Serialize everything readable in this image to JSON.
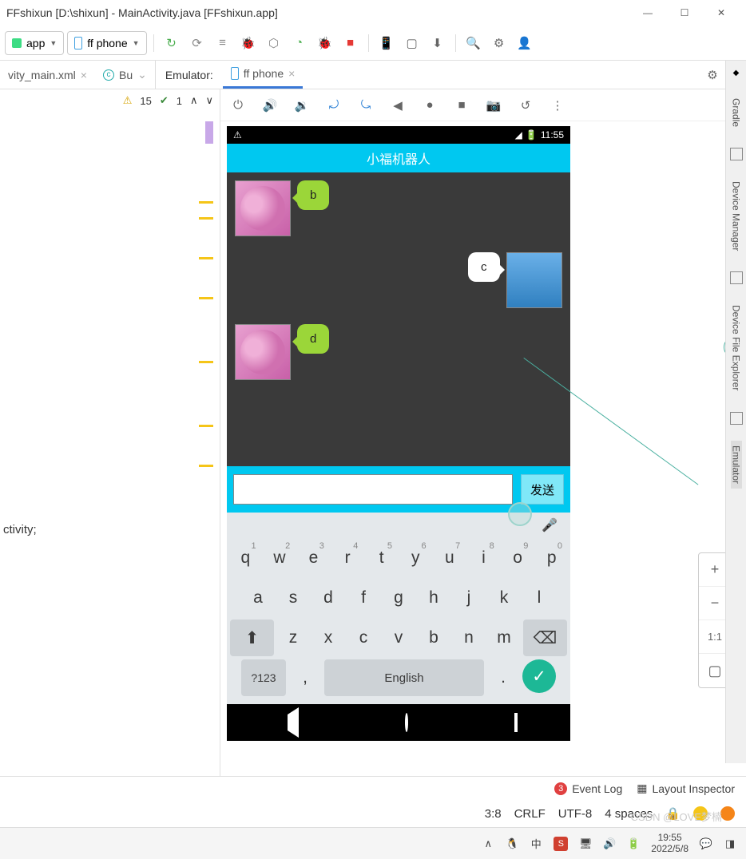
{
  "titlebar": {
    "text": "FFshixun [D:\\shixun] - MainActivity.java [FFshixun.app]"
  },
  "toolbar": {
    "module": "app",
    "device": "ff phone"
  },
  "tabs": {
    "left1": "vity_main.xml",
    "left2": "Bu",
    "emulator_label": "Emulator:",
    "emu_tab": "ff phone"
  },
  "warnings": {
    "warn_count": "15",
    "ok_count": "1"
  },
  "code": {
    "line": "ctivity;"
  },
  "phone": {
    "status_time": "11:55",
    "app_title": "小福机器人",
    "msgs": [
      {
        "side": "left",
        "text": "b",
        "bubble": "green"
      },
      {
        "side": "right",
        "text": "c",
        "bubble": "white"
      },
      {
        "side": "left",
        "text": "d",
        "bubble": "green"
      }
    ],
    "send": "发送",
    "input_value": ""
  },
  "keyboard": {
    "row1": [
      {
        "k": "q",
        "s": "1"
      },
      {
        "k": "w",
        "s": "2"
      },
      {
        "k": "e",
        "s": "3"
      },
      {
        "k": "r",
        "s": "4"
      },
      {
        "k": "t",
        "s": "5"
      },
      {
        "k": "y",
        "s": "6"
      },
      {
        "k": "u",
        "s": "7"
      },
      {
        "k": "i",
        "s": "8"
      },
      {
        "k": "o",
        "s": "9"
      },
      {
        "k": "p",
        "s": "0"
      }
    ],
    "row2": [
      "a",
      "s",
      "d",
      "f",
      "g",
      "h",
      "j",
      "k",
      "l"
    ],
    "row3": [
      "z",
      "x",
      "c",
      "v",
      "b",
      "n",
      "m"
    ],
    "sym": "?123",
    "space": "English",
    "comma": ",",
    "period": "."
  },
  "zoom": {
    "plus": "+",
    "minus": "−",
    "fit": "1:1",
    "box": "▢"
  },
  "rightbar": {
    "items": [
      "Gradle",
      "Device Manager",
      "Device File Explorer",
      "Emulator"
    ]
  },
  "statusbar1": {
    "event_count": "3",
    "event_log": "Event Log",
    "layout": "Layout Inspector"
  },
  "statusbar2": {
    "pos": "3:8",
    "eol": "CRLF",
    "enc": "UTF-8",
    "indent": "4 spaces"
  },
  "taskbar": {
    "time": "19:55",
    "date": "2022/5/8"
  },
  "watermark": "CSDN @LOVE梦楠"
}
